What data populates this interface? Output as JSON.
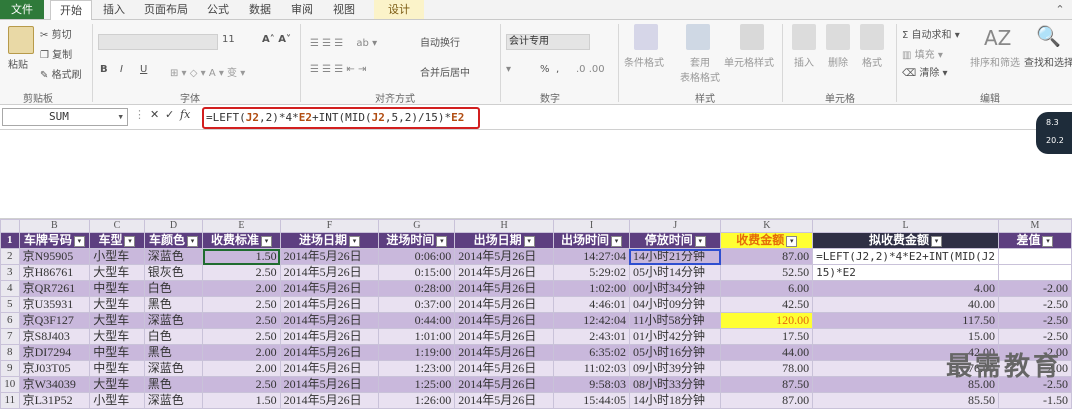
{
  "tabs": [
    "文件",
    "开始",
    "插入",
    "页面布局",
    "公式",
    "数据",
    "审阅",
    "视图",
    "设计"
  ],
  "ribbon": {
    "clipboard": {
      "paste": "粘贴",
      "cut": "剪切",
      "copy": "复制",
      "format_painter": "格式刷",
      "label": "剪贴板"
    },
    "font": {
      "size": "11",
      "label": "字体",
      "bold": "B",
      "italic": "I",
      "underline": "U"
    },
    "alignment": {
      "wrap": "自动换行",
      "merge": "合并后居中",
      "label": "对齐方式"
    },
    "number": {
      "format": "会计专用",
      "percent": "%",
      "comma": ",",
      "label": "数字"
    },
    "styles": {
      "conditional": "条件格式",
      "table": "套用\n表格格式",
      "cell": "单元格样式",
      "label": "样式"
    },
    "cells": {
      "insert": "插入",
      "delete": "删除",
      "format": "格式",
      "label": "单元格"
    },
    "editing": {
      "autosum": "自动求和",
      "fill": "填充",
      "clear": "清除",
      "sort": "排序和筛选",
      "find": "查找和选择",
      "label": "编辑"
    }
  },
  "formula_bar": {
    "name_box": "SUM",
    "fx": "fx",
    "formula_parts": [
      {
        "t": "=LEFT(",
        "c": "n"
      },
      {
        "t": "J2",
        "c": "r"
      },
      {
        "t": ",2)*4*",
        "c": "n"
      },
      {
        "t": "E2",
        "c": "r"
      },
      {
        "t": "+INT(MID(",
        "c": "n"
      },
      {
        "t": "J2",
        "c": "r"
      },
      {
        "t": ",5,2)/15)*",
        "c": "n"
      },
      {
        "t": "E2",
        "c": "r"
      }
    ]
  },
  "side_bubble": {
    "line1": "8.3",
    "line2": "20.2"
  },
  "columns": [
    "",
    "B",
    "C",
    "D",
    "E",
    "F",
    "G",
    "H",
    "I",
    "J",
    "K",
    "L",
    "M"
  ],
  "header_row": [
    "车牌号码",
    "车型",
    "车颜色",
    "收费标准",
    "进场日期",
    "进场时间",
    "出场日期",
    "出场时间",
    "停放时间",
    "收费金额",
    "拟收费金额",
    "差值"
  ],
  "rows": [
    {
      "n": "2",
      "cells": [
        "京N95905",
        "小型车",
        "深蓝色",
        "1.50",
        "2014年5月26日",
        "0:06:00",
        "2014年5月26日",
        "14:27:04",
        "14小时21分钟",
        "87.00",
        "=LEFT(J2,2)*4*E2+INT(MID(J2",
        ""
      ]
    },
    {
      "n": "3",
      "cells": [
        "京H86761",
        "大型车",
        "银灰色",
        "2.50",
        "2014年5月26日",
        "0:15:00",
        "2014年5月26日",
        "5:29:02",
        "05小时14分钟",
        "52.50",
        "15)*E2",
        ""
      ]
    },
    {
      "n": "4",
      "cells": [
        "京QR7261",
        "中型车",
        "白色",
        "2.00",
        "2014年5月26日",
        "0:28:00",
        "2014年5月26日",
        "1:02:00",
        "00小时34分钟",
        "6.00",
        "4.00",
        "-2.00"
      ]
    },
    {
      "n": "5",
      "cells": [
        "京U35931",
        "大型车",
        "黑色",
        "2.50",
        "2014年5月26日",
        "0:37:00",
        "2014年5月26日",
        "4:46:01",
        "04小时09分钟",
        "42.50",
        "40.00",
        "-2.50"
      ]
    },
    {
      "n": "6",
      "cells": [
        "京Q3F127",
        "大型车",
        "深蓝色",
        "2.50",
        "2014年5月26日",
        "0:44:00",
        "2014年5月26日",
        "12:42:04",
        "11小时58分钟",
        "120.00",
        "117.50",
        "-2.50"
      ]
    },
    {
      "n": "7",
      "cells": [
        "京S8J403",
        "大型车",
        "白色",
        "2.50",
        "2014年5月26日",
        "1:01:00",
        "2014年5月26日",
        "2:43:01",
        "01小时42分钟",
        "17.50",
        "15.00",
        "-2.50"
      ]
    },
    {
      "n": "8",
      "cells": [
        "京DI7294",
        "中型车",
        "黑色",
        "2.00",
        "2014年5月26日",
        "1:19:00",
        "2014年5月26日",
        "6:35:02",
        "05小时16分钟",
        "44.00",
        "42.00",
        "-2.00"
      ]
    },
    {
      "n": "9",
      "cells": [
        "京J03T05",
        "中型车",
        "深蓝色",
        "2.00",
        "2014年5月26日",
        "1:23:00",
        "2014年5月26日",
        "11:02:03",
        "09小时39分钟",
        "78.00",
        "76.00",
        "-2.00"
      ]
    },
    {
      "n": "10",
      "cells": [
        "京W34039",
        "大型车",
        "黑色",
        "2.50",
        "2014年5月26日",
        "1:25:00",
        "2014年5月26日",
        "9:58:03",
        "08小时33分钟",
        "87.50",
        "85.00",
        "-2.50"
      ]
    },
    {
      "n": "11",
      "cells": [
        "京L31P52",
        "小型车",
        "深蓝色",
        "1.50",
        "2014年5月26日",
        "1:26:00",
        "2014年5月26日",
        "15:44:05",
        "14小时18分钟",
        "87.00",
        "85.50",
        "-1.50"
      ]
    }
  ],
  "watermark": "最需教育",
  "colors": {
    "header": "#5d3f80",
    "odd": "#c9b8dc",
    "even": "#e9e1f1",
    "highlight": "#ffff33",
    "formula_border": "#d21f1f"
  }
}
